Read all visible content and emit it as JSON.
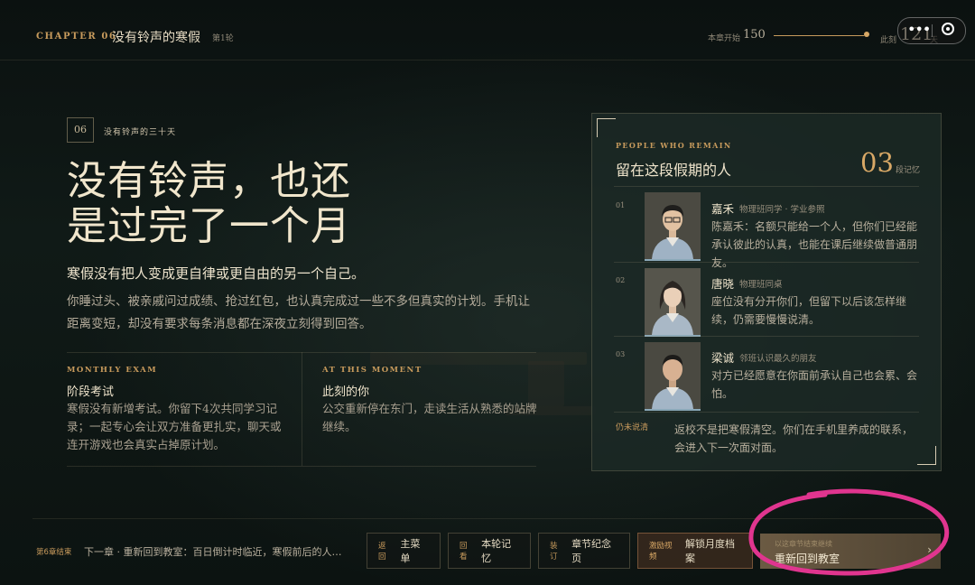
{
  "header": {
    "chapter_code": "CHAPTER 06",
    "chapter_title": "没有铃声的寒假",
    "round": "第1轮",
    "progress": {
      "start_label": "本章开始",
      "start_value": "150",
      "now_label": "此刻",
      "now_value": "121",
      "unit": "天",
      "fraction": 0.98
    }
  },
  "section": {
    "badge": "06",
    "label": "没有铃声的三十天",
    "headline_line1": "没有铃声，也还",
    "headline_line2": "是过完了一个月",
    "lead": "寒假没有把人变成更自律或更自由的另一个自己。",
    "body": "你睡过头、被亲戚问过成绩、抢过红包，也认真完成过一些不多但真实的计划。手机让距离变短，却没有要求每条消息都在深夜立刻得到回答。"
  },
  "cards": [
    {
      "eyebrow": "MONTHLY EXAM",
      "title": "阶段考试",
      "body": "寒假没有新增考试。你留下4次共同学习记录；一起专心会让双方准备更扎实，聊天或连开游戏也会真实占掉原计划。"
    },
    {
      "eyebrow": "AT THIS MOMENT",
      "title": "此刻的你",
      "body": "公交重新停在东门，走读生活从熟悉的站牌继续。"
    }
  ],
  "panel": {
    "eyebrow": "PEOPLE WHO REMAIN",
    "title": "留在这段假期的人",
    "count": "03",
    "count_label": "段记忆",
    "people": [
      {
        "num": "01",
        "name": "嘉禾",
        "role": "物理班同学 · 学业参照",
        "text": "陈嘉禾：名额只能给一个人，但你们已经能承认彼此的认真，也能在课后继续做普通朋友。"
      },
      {
        "num": "02",
        "name": "唐晓",
        "role": "物理班同桌",
        "text": "座位没有分开你们，但留下以后该怎样继续，仍需要慢慢说清。"
      },
      {
        "num": "03",
        "name": "梁诚",
        "role": "邻班认识最久的朋友",
        "text": "对方已经愿意在你面前承认自己也会累、会怕。"
      }
    ],
    "note_label": "仍未说清",
    "note": "返校不是把寒假清空。你们在手机里养成的联系，会进入下一次面对面。"
  },
  "footer": {
    "end_label": "第6章结束",
    "next_text": "下一章 · 重新回到教室：百日倒计时临近，寒假前后的人…",
    "buttons": [
      {
        "k": "返回",
        "v": "主菜单"
      },
      {
        "k": "回看",
        "v": "本轮记忆"
      },
      {
        "k": "装订",
        "v": "章节纪念页"
      },
      {
        "k": "激励视频",
        "v": "解锁月度档案"
      }
    ],
    "primary": {
      "k": "以这章节结束继续",
      "v": "重新回到教室",
      "chev": "›"
    }
  },
  "colors": {
    "accent": "#c79a5c",
    "annotation": "#e0358f"
  }
}
